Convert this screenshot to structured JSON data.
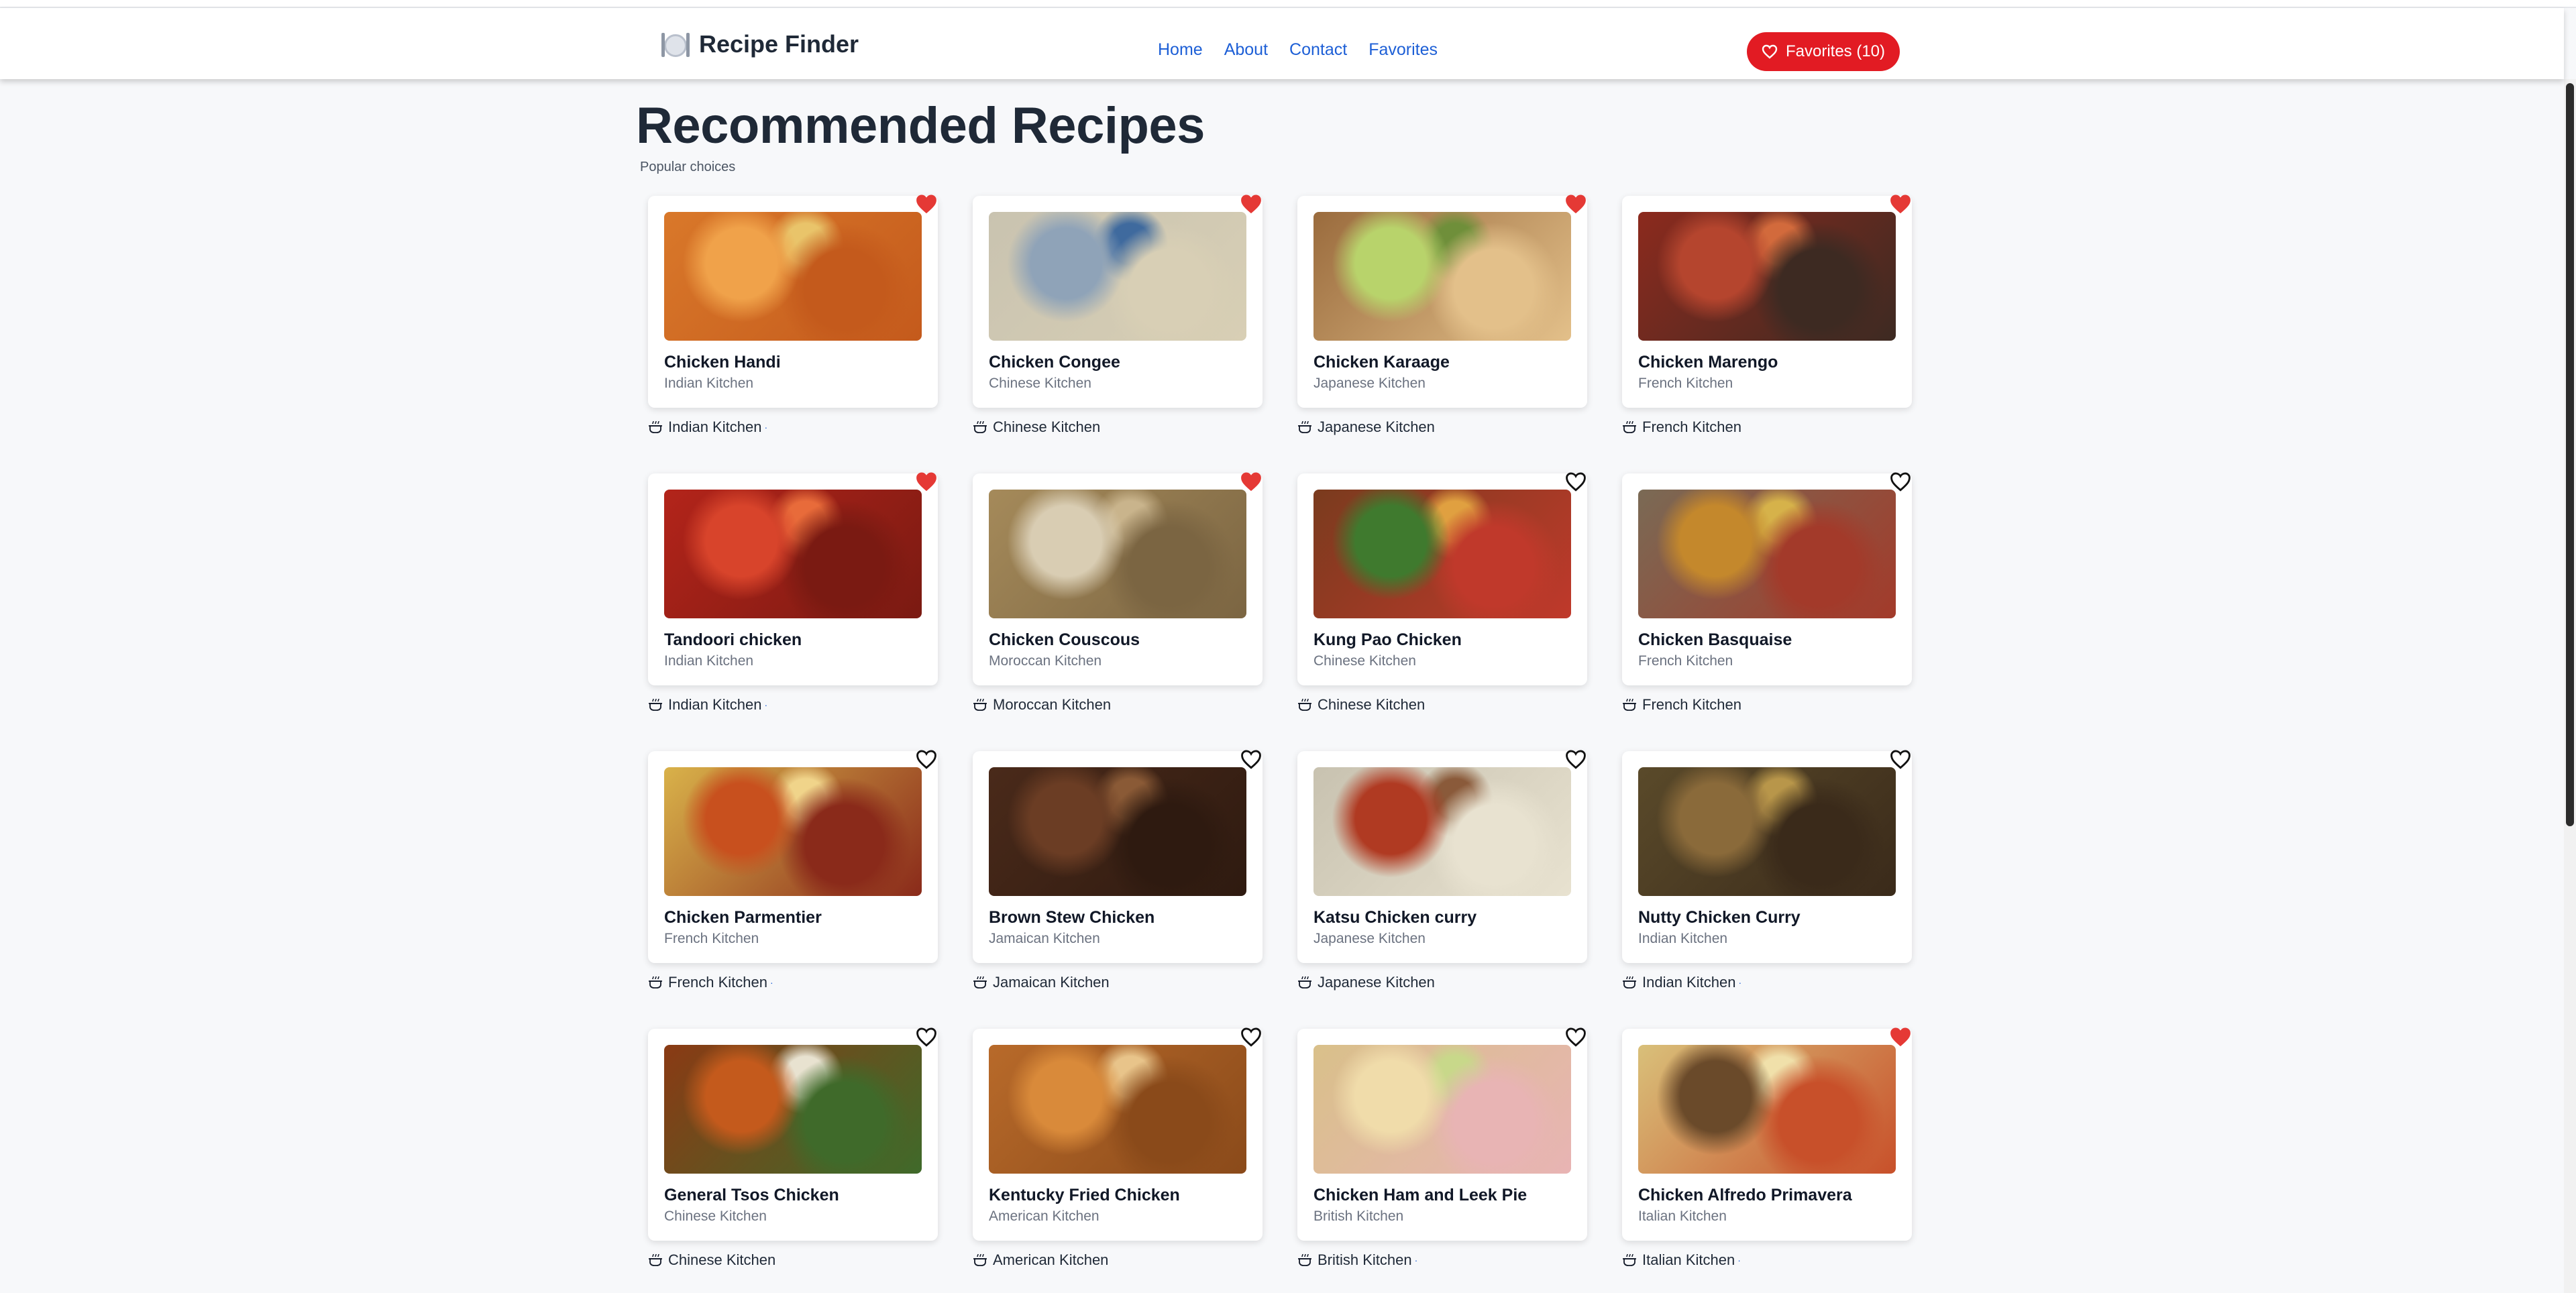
{
  "app": {
    "title": "Recipe Finder",
    "brand_icon": "plate-cutlery-icon"
  },
  "nav": {
    "links": [
      "Home",
      "About",
      "Contact",
      "Favorites"
    ]
  },
  "favorites_button": {
    "label": "Favorites (10)",
    "icon": "heart-outline-icon",
    "count": 10
  },
  "page": {
    "title": "Recommended Recipes",
    "subtitle": "Popular choices"
  },
  "colors": {
    "accent": "#e21b23",
    "link": "#1d5fd6",
    "heart_filled": "#e53935"
  },
  "recipes": [
    {
      "name": "Chicken Handi",
      "kitchen": "Indian Kitchen",
      "favorite": true,
      "extra_dot": true
    },
    {
      "name": "Chicken Congee",
      "kitchen": "Chinese Kitchen",
      "favorite": true,
      "extra_dot": false
    },
    {
      "name": "Chicken Karaage",
      "kitchen": "Japanese Kitchen",
      "favorite": true,
      "extra_dot": false
    },
    {
      "name": "Chicken Marengo",
      "kitchen": "French Kitchen",
      "favorite": true,
      "extra_dot": false
    },
    {
      "name": "Tandoori chicken",
      "kitchen": "Indian Kitchen",
      "favorite": true,
      "extra_dot": true
    },
    {
      "name": "Chicken Couscous",
      "kitchen": "Moroccan Kitchen",
      "favorite": true,
      "extra_dot": false
    },
    {
      "name": "Kung Pao Chicken",
      "kitchen": "Chinese Kitchen",
      "favorite": false,
      "extra_dot": false
    },
    {
      "name": "Chicken Basquaise",
      "kitchen": "French Kitchen",
      "favorite": false,
      "extra_dot": false
    },
    {
      "name": "Chicken Parmentier",
      "kitchen": "French Kitchen",
      "favorite": false,
      "extra_dot": true
    },
    {
      "name": "Brown Stew Chicken",
      "kitchen": "Jamaican Kitchen",
      "favorite": false,
      "extra_dot": false
    },
    {
      "name": "Katsu Chicken curry",
      "kitchen": "Japanese Kitchen",
      "favorite": false,
      "extra_dot": false
    },
    {
      "name": "Nutty Chicken Curry",
      "kitchen": "Indian Kitchen",
      "favorite": false,
      "extra_dot": true
    },
    {
      "name": "General Tsos Chicken",
      "kitchen": "Chinese Kitchen",
      "favorite": false,
      "extra_dot": false
    },
    {
      "name": "Kentucky Fried Chicken",
      "kitchen": "American Kitchen",
      "favorite": false,
      "extra_dot": false
    },
    {
      "name": "Chicken Ham and Leek Pie",
      "kitchen": "British Kitchen",
      "favorite": false,
      "extra_dot": true
    },
    {
      "name": "Chicken Alfredo Primavera",
      "kitchen": "Italian Kitchen",
      "favorite": true,
      "extra_dot": true
    }
  ]
}
